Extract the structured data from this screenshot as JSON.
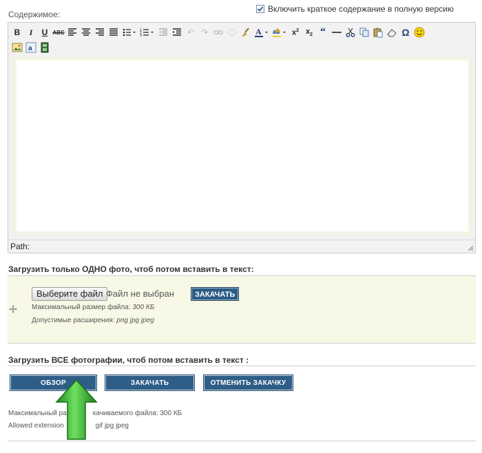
{
  "editor": {
    "content_label": "Содержимое:",
    "summary_checkbox_label": "Включить краткое содержание в полную версию",
    "summary_checked": true,
    "path_label": "Path:",
    "toolbar_row1": [
      {
        "name": "bold-icon",
        "glyph": "B"
      },
      {
        "name": "italic-icon",
        "glyph": "I"
      },
      {
        "name": "underline-icon",
        "glyph": "U"
      },
      {
        "name": "strikethrough-icon",
        "glyph": "ABC"
      },
      {
        "name": "align-left-icon",
        "glyph": "align-left"
      },
      {
        "name": "align-center-icon",
        "glyph": "align-center"
      },
      {
        "name": "align-right-icon",
        "glyph": "align-right"
      },
      {
        "name": "align-justify-icon",
        "glyph": "align-justify"
      },
      {
        "name": "bullet-list-icon",
        "glyph": "ul"
      },
      {
        "name": "numbered-list-icon",
        "glyph": "ol"
      },
      {
        "name": "outdent-icon",
        "glyph": "outdent"
      },
      {
        "name": "indent-icon",
        "glyph": "indent"
      },
      {
        "name": "undo-icon",
        "glyph": "↶"
      },
      {
        "name": "redo-icon",
        "glyph": "↷"
      },
      {
        "name": "link-icon",
        "glyph": "link"
      },
      {
        "name": "unlink-icon",
        "glyph": "unlink"
      },
      {
        "name": "clean-format-icon",
        "glyph": "broom"
      },
      {
        "name": "text-color-icon",
        "glyph": "A"
      },
      {
        "name": "highlight-color-icon",
        "glyph": "ab"
      },
      {
        "name": "superscript-icon",
        "glyph": "x²"
      },
      {
        "name": "subscript-icon",
        "glyph": "x₂"
      },
      {
        "name": "blockquote-icon",
        "glyph": "“"
      },
      {
        "name": "horizontal-rule-icon",
        "glyph": "—"
      },
      {
        "name": "cut-icon",
        "glyph": "✂"
      },
      {
        "name": "copy-icon",
        "glyph": "copy"
      },
      {
        "name": "paste-icon",
        "glyph": "paste"
      },
      {
        "name": "eraser-icon",
        "glyph": "eraser"
      },
      {
        "name": "omega-icon",
        "glyph": "Ω"
      },
      {
        "name": "smiley-icon",
        "glyph": "☺"
      }
    ],
    "toolbar_row2": [
      {
        "name": "insert-image-icon"
      },
      {
        "name": "insert-anchor-icon"
      },
      {
        "name": "insert-media-icon"
      }
    ]
  },
  "upload_single": {
    "title": "Загрузить только ОДНО фото, чтоб потом вставить в текст:",
    "choose_file_label": "Выберите файл",
    "file_status": "Файл не выбран",
    "upload_button": "ЗАКАЧАТЬ",
    "max_size_label": "Максимальный размер файла:",
    "max_size_value": "300 КБ",
    "extensions_label": "Допустимые расширения:",
    "extensions_value": "png jpg jpeg"
  },
  "upload_all": {
    "title": "Загрузить ВСЕ фотографии, чтоб потом вставить в текст :",
    "browse_button": "ОБЗОР",
    "upload_button": "ЗАКАЧАТЬ",
    "cancel_button": "ОТМЕНИТЬ ЗАКАЧКУ",
    "max_size_text_start": "Максимальный ра",
    "max_size_text_end": "качиваемого файла: 300 КБ",
    "extensions_text_start": "Allowed extension",
    "extensions_text_end": "gif jpg jpeg"
  },
  "colors": {
    "button_blue": "#2e5e88",
    "arrow_green": "#2fa82a",
    "upload_box_bg": "#f8f8e6"
  }
}
